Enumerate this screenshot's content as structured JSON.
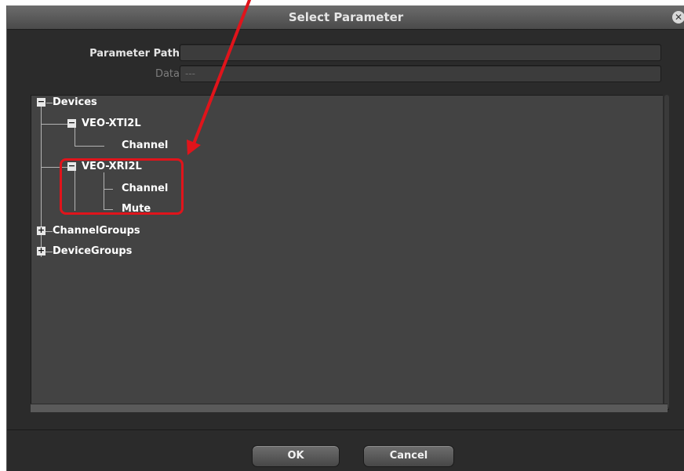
{
  "dialog": {
    "title": "Select Parameter",
    "close_icon": "close-icon"
  },
  "fields": {
    "parameter_path_label": "Parameter Path",
    "parameter_path_value": "",
    "data_label": "Data",
    "data_value": "---"
  },
  "tree": {
    "devices": "Devices",
    "device1": "VEO-XTI2L",
    "device1_channel": "Channel",
    "device2": "VEO-XRI2L",
    "device2_channel": "Channel",
    "device2_mute": "Mute",
    "channel_groups": "ChannelGroups",
    "device_groups": "DeviceGroups",
    "expanded_symbol": "−",
    "collapsed_symbol": "+"
  },
  "buttons": {
    "ok": "OK",
    "cancel": "Cancel"
  },
  "annotation": {
    "color": "#e0141b"
  }
}
